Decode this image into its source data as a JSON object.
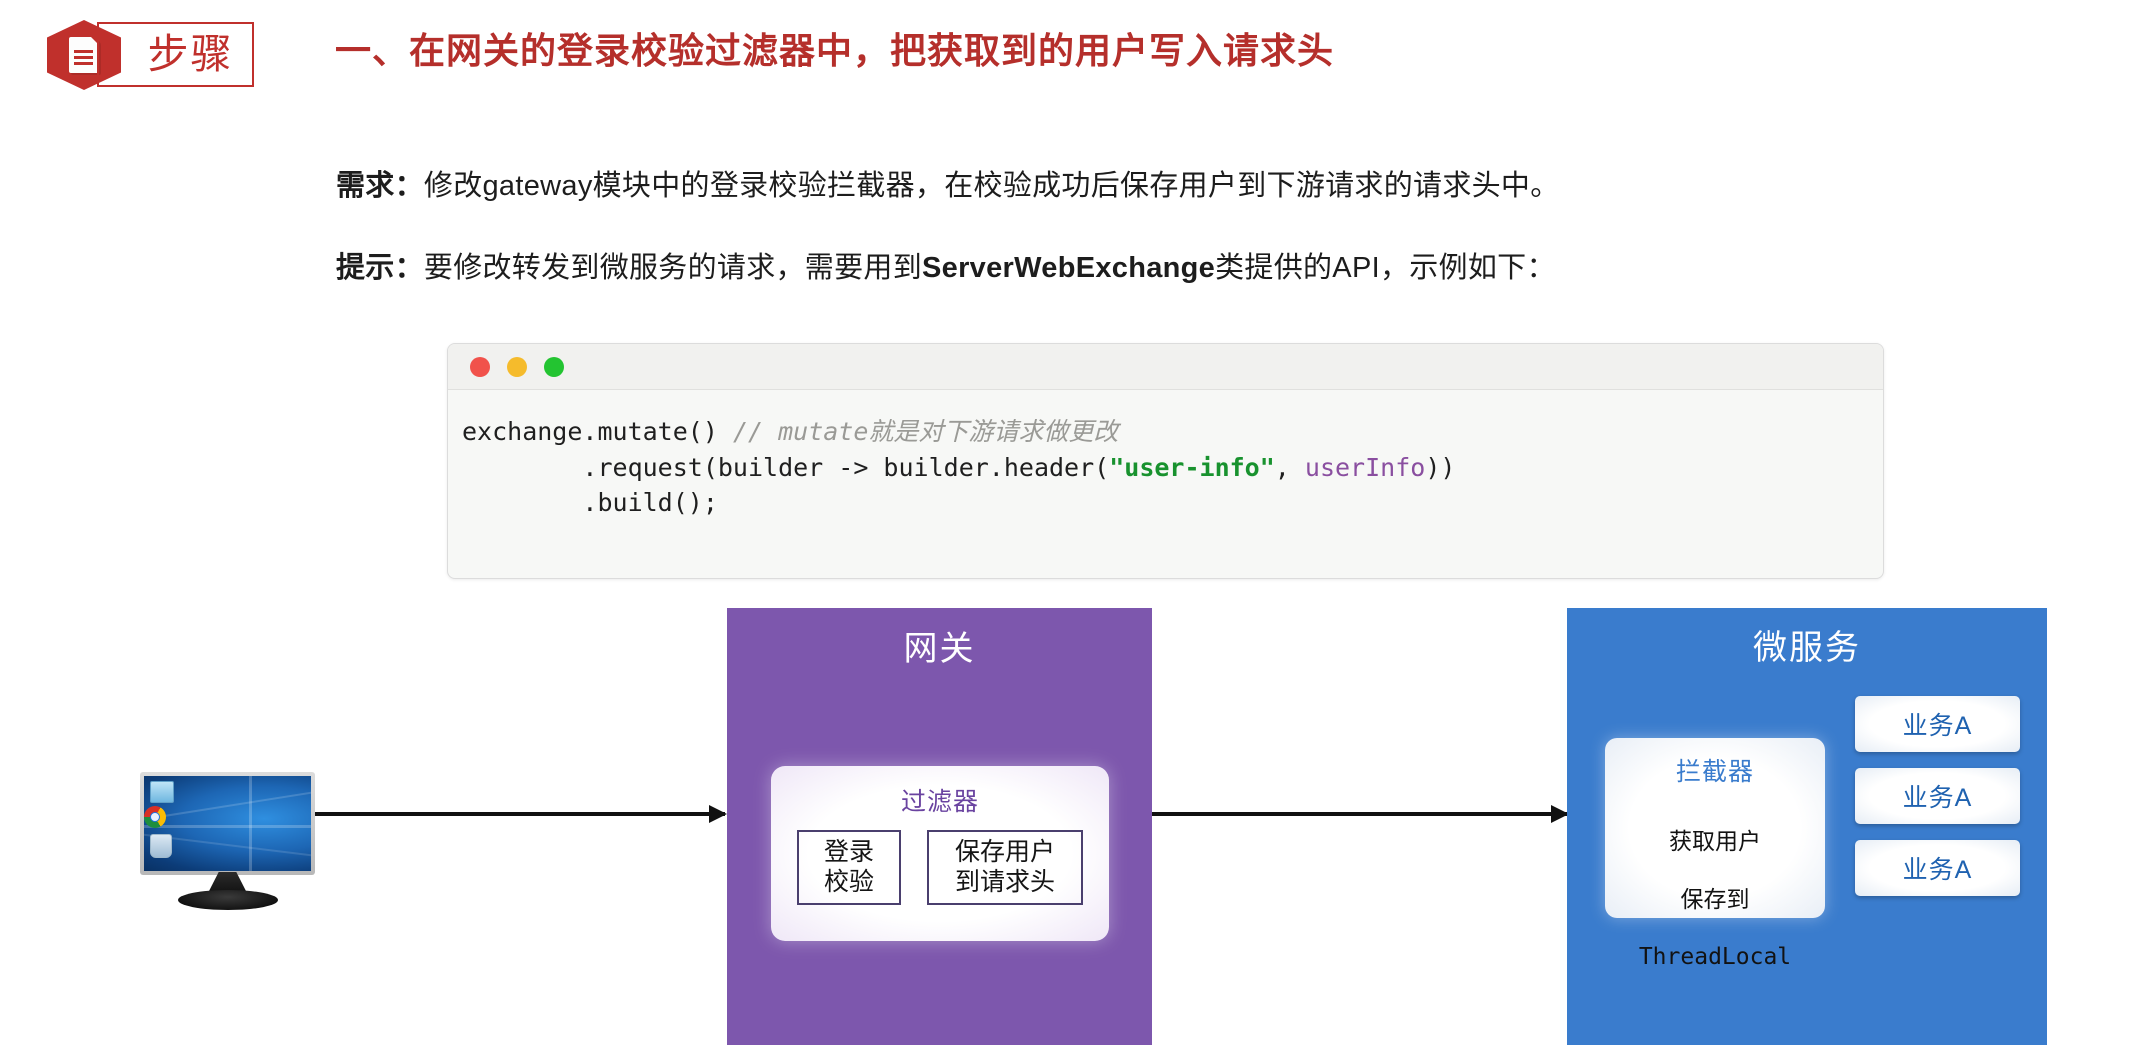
{
  "header": {
    "badge_label": "步骤",
    "badge_icon": "document-icon",
    "title": "一、在网关的登录校验过滤器中，把获取到的用户写入请求头"
  },
  "body": {
    "requirement": {
      "lead": "需求：",
      "text": "修改gateway模块中的登录校验拦截器，在校验成功后保存用户到下游请求的请求头中。"
    },
    "hint": {
      "lead": "提示：",
      "text_before": "要修改转发到微服务的请求，需要用到",
      "strong": "ServerWebExchange",
      "text_after": "类提供的API，示例如下："
    }
  },
  "code_window": {
    "traffic_lights": [
      "close-red",
      "minimize-yellow",
      "maximize-green"
    ],
    "lines": [
      {
        "id": "line1",
        "code": "exchange.mutate() ",
        "comment": "// mutate就是对下游请求做更改"
      },
      {
        "id": "line2",
        "prefix": "        .request(builder -> builder.header(",
        "string": "\"user-info\"",
        "middle": ", ",
        "variable": "userInfo",
        "suffix": "))"
      },
      {
        "id": "line3",
        "code": "        .build();"
      }
    ]
  },
  "diagram": {
    "client": {
      "icon": "desktop-monitor-icon",
      "desktop_icons": [
        "my-computer-icon",
        "chrome-icon",
        "recycle-bin-icon"
      ]
    },
    "arrows": [
      {
        "name": "client-to-gateway"
      },
      {
        "name": "gateway-to-service"
      }
    ],
    "gateway": {
      "title": "网关",
      "color": "#7d57ad",
      "filter": {
        "title": "过滤器",
        "boxes": [
          {
            "id": "login-check",
            "label": "登录\n校验"
          },
          {
            "id": "save-user",
            "label": "保存用户\n到请求头"
          }
        ]
      }
    },
    "service": {
      "title": "微服务",
      "color": "#3a7ccd",
      "interceptor": {
        "title": "拦截器",
        "line1": "获取用户",
        "line2": "保存到",
        "line3": "ThreadLocal"
      },
      "business_boxes": [
        {
          "id": "biz-1",
          "label": "业务A"
        },
        {
          "id": "biz-2",
          "label": "业务A"
        },
        {
          "id": "biz-3",
          "label": "业务A"
        }
      ]
    }
  }
}
